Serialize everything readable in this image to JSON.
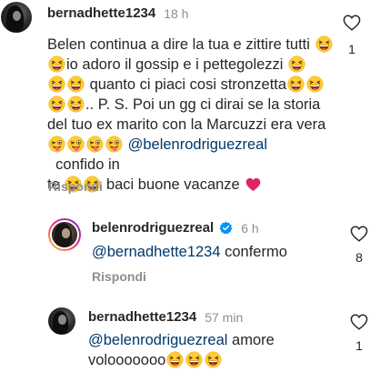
{
  "comments": [
    {
      "username": "bernadhette1234",
      "time": "18 h",
      "likes": "1",
      "lines": [
        {
          "segments": [
            {
              "t": "Belen continua a dire la tua e zittire tutti "
            },
            {
              "e": "laugh"
            }
          ]
        },
        {
          "segments": [
            {
              "e": "laugh"
            },
            {
              "t": "io adoro il gossip e i pettegolezzi "
            },
            {
              "e": "laugh"
            }
          ]
        },
        {
          "segments": [
            {
              "e": "laugh"
            },
            {
              "e": "laugh"
            },
            {
              "t": " quanto ci piaci cosi stronzetta"
            },
            {
              "e": "laugh"
            },
            {
              "e": "laugh"
            }
          ]
        },
        {
          "segments": [
            {
              "e": "laugh"
            },
            {
              "e": "laugh"
            },
            {
              "t": ".. P. S. Poi un gg ci dirai se la storia"
            }
          ]
        },
        {
          "segments": [
            {
              "t": "del tuo ex marito con la Marcuzzi era vera"
            }
          ]
        },
        {
          "segments": [
            {
              "e": "wink"
            },
            {
              "e": "wink"
            },
            {
              "e": "wink"
            },
            {
              "e": "wink"
            },
            {
              "t": " "
            },
            {
              "m": "@belenrodriguezreal"
            },
            {
              "t": "  confido in"
            }
          ]
        },
        {
          "segments": [
            {
              "t": "te "
            },
            {
              "e": "laugh"
            },
            {
              "e": "laugh"
            },
            {
              "t": " baci buone vacanze "
            },
            {
              "h": "red-heart"
            }
          ]
        }
      ],
      "reply_label": "Rispondi"
    },
    {
      "username": "belenrodriguezreal",
      "time": "6 h",
      "likes": "8",
      "mention": "@bernadhette1234",
      "text": " confermo",
      "reply_label": "Rispondi"
    },
    {
      "username": "bernadhette1234",
      "time": "57 min",
      "likes": "1",
      "mention": "@belenrodriguezreal",
      "text_line1": " amore",
      "text_line2": "volooooooo",
      "emoji_count": 3
    }
  ],
  "icons": {
    "like": "heart-outline-icon",
    "verified": "verified-badge-icon",
    "emoji_laugh": "grinning-squinting-face-emoji",
    "emoji_wink": "winking-face-with-tongue-emoji",
    "emoji_heart": "red-heart-emoji"
  },
  "colors": {
    "text": "#262626",
    "muted": "#8e8e8e",
    "mention": "#00376b",
    "verified": "#0095f6",
    "heart": "#e0245e"
  }
}
